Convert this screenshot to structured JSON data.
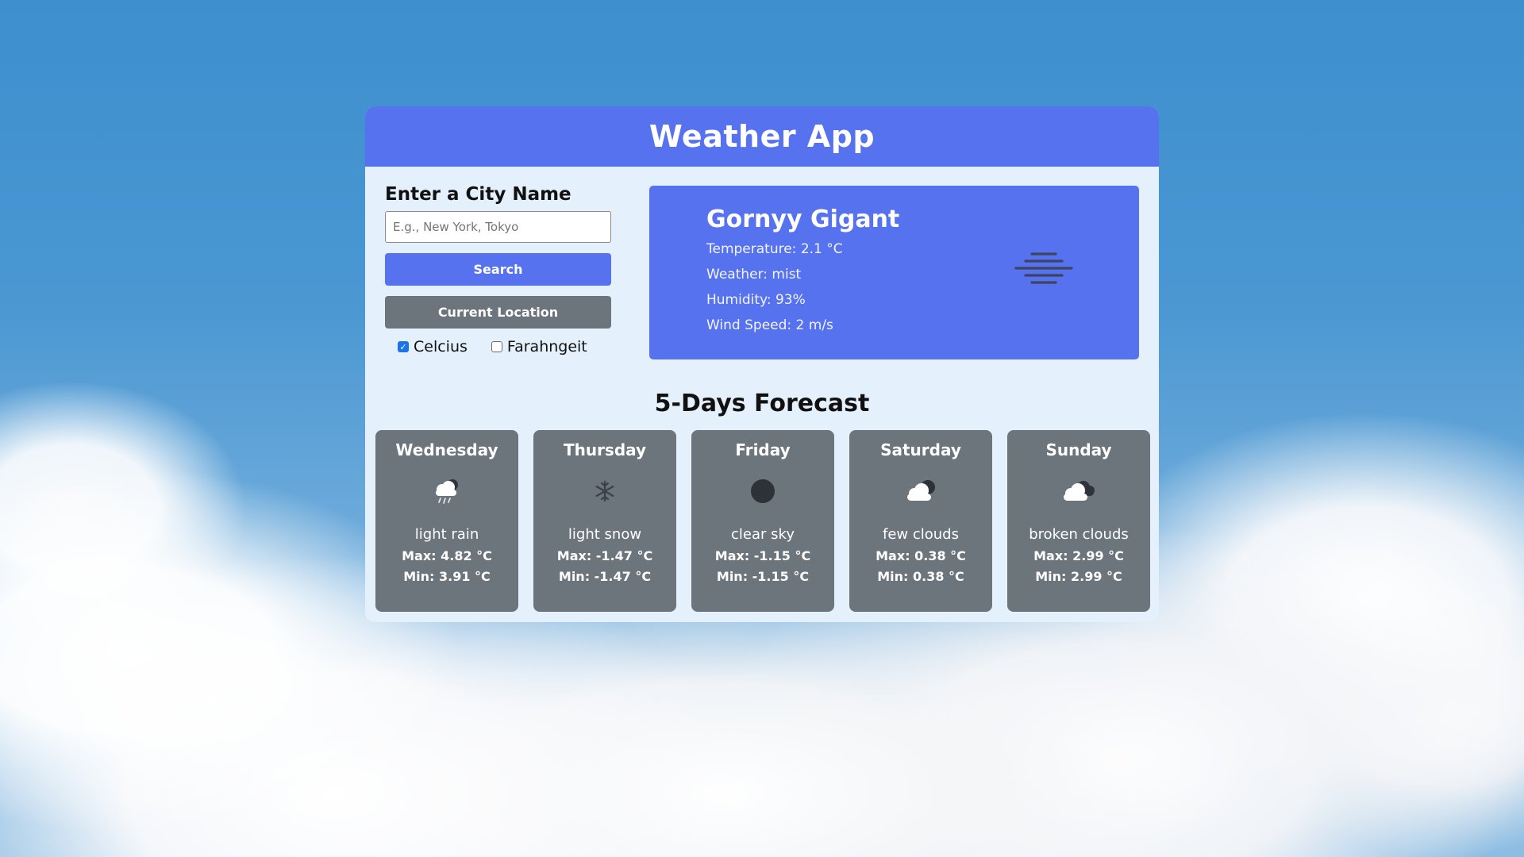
{
  "app": {
    "title": "Weather App"
  },
  "search": {
    "label": "Enter a City Name",
    "placeholder": "E.g., New York, Tokyo",
    "value": "",
    "search_button": "Search",
    "location_button": "Current Location"
  },
  "units": {
    "celsius_label": "Celcius",
    "celsius_checked": true,
    "fahrenheit_label": "Farahngeit",
    "fahrenheit_checked": false
  },
  "current": {
    "city": "Gornyy Gigant",
    "temperature": "Temperature: 2.1 °C",
    "weather": "Weather: mist",
    "humidity": "Humidity: 93%",
    "wind": "Wind Speed: 2 m/s",
    "icon": "mist-icon"
  },
  "forecast": {
    "title": "5-Days Forecast",
    "days": [
      {
        "day": "Wednesday",
        "icon": "light-rain-icon",
        "desc": "light rain",
        "max": "Max: 4.82 °C",
        "min": "Min: 3.91 °C"
      },
      {
        "day": "Thursday",
        "icon": "snow-icon",
        "desc": "light snow",
        "max": "Max: -1.47 °C",
        "min": "Min: -1.47 °C"
      },
      {
        "day": "Friday",
        "icon": "clear-sky-icon",
        "desc": "clear sky",
        "max": "Max: -1.15 °C",
        "min": "Min: -1.15 °C"
      },
      {
        "day": "Saturday",
        "icon": "few-clouds-icon",
        "desc": "few clouds",
        "max": "Max: 0.38 °C",
        "min": "Min: 0.38 °C"
      },
      {
        "day": "Sunday",
        "icon": "broken-clouds-icon",
        "desc": "broken clouds",
        "max": "Max: 2.99 °C",
        "min": "Min: 2.99 °C"
      }
    ]
  },
  "colors": {
    "primary": "#5672ee",
    "card_gray": "#6c747c",
    "panel_bg": "#e4f0fb"
  }
}
